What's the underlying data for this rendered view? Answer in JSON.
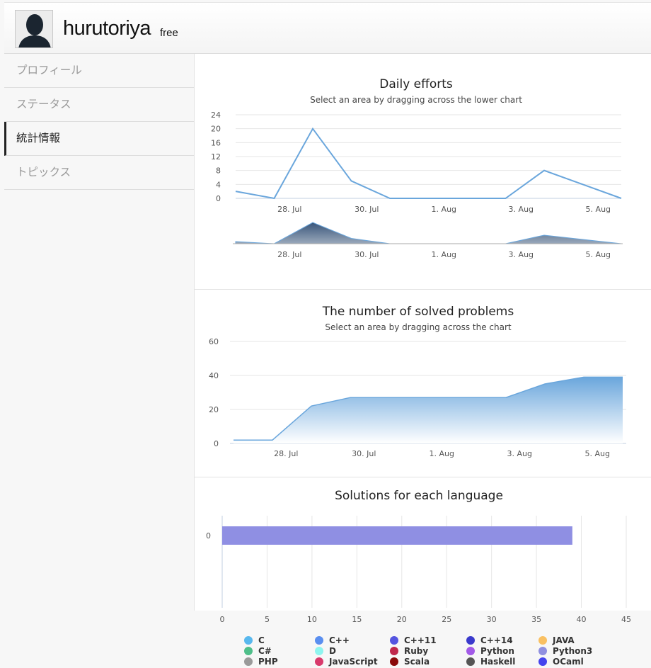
{
  "user": {
    "name": "hurutoriya",
    "plan": "free"
  },
  "sidebar": {
    "items": [
      {
        "label": "プロフィール",
        "active": false
      },
      {
        "label": "ステータス",
        "active": false
      },
      {
        "label": "統計情報",
        "active": true
      },
      {
        "label": "トピックス",
        "active": false
      }
    ]
  },
  "chart_data": [
    {
      "type": "line",
      "title": "Daily efforts",
      "subtitle": "Select an area by dragging across the lower chart",
      "x_tick_labels": [
        "28. Jul",
        "30. Jul",
        "1. Aug",
        "3. Aug",
        "5. Aug"
      ],
      "y_tick_labels": [
        "0",
        "4",
        "8",
        "12",
        "16",
        "20",
        "24"
      ],
      "ylim": [
        0,
        24
      ],
      "x": [
        0,
        1,
        2,
        3,
        4,
        5,
        6,
        7,
        8,
        9,
        10
      ],
      "series": [
        {
          "values": [
            2,
            0,
            20,
            5,
            0,
            0,
            0,
            0,
            8,
            4,
            0
          ],
          "color": "#6aa6dc"
        }
      ],
      "navigator": true
    },
    {
      "type": "area",
      "title": "The number of solved problems",
      "subtitle": "Select an area by dragging across the chart",
      "x_tick_labels": [
        "28. Jul",
        "30. Jul",
        "1. Aug",
        "3. Aug",
        "5. Aug"
      ],
      "y_tick_labels": [
        "0",
        "20",
        "40",
        "60"
      ],
      "ylim": [
        0,
        60
      ],
      "x": [
        0,
        1,
        2,
        3,
        4,
        5,
        6,
        7,
        8,
        9,
        10
      ],
      "series": [
        {
          "values": [
            2,
            2,
            22,
            27,
            27,
            27,
            27,
            27,
            35,
            39,
            39
          ],
          "color": "#6aa6dc"
        }
      ]
    },
    {
      "type": "bar",
      "orientation": "horizontal",
      "title": "Solutions for each language",
      "categories": [
        "0"
      ],
      "values": [
        39
      ],
      "bar_color": "#8f8fe3",
      "xlim": [
        0,
        45
      ],
      "x_tick_labels": [
        "0",
        "5",
        "10",
        "15",
        "20",
        "25",
        "30",
        "35",
        "40",
        "45"
      ],
      "legend": [
        {
          "name": "C",
          "color": "#58b8ee"
        },
        {
          "name": "C++",
          "color": "#5a8ff0"
        },
        {
          "name": "C++11",
          "color": "#5555e0"
        },
        {
          "name": "C++14",
          "color": "#3a3acc"
        },
        {
          "name": "JAVA",
          "color": "#f9c062"
        },
        {
          "name": "C#",
          "color": "#4fbf8a"
        },
        {
          "name": "D",
          "color": "#8ff5ef"
        },
        {
          "name": "Ruby",
          "color": "#c0284b"
        },
        {
          "name": "Python",
          "color": "#a25ae8"
        },
        {
          "name": "Python3",
          "color": "#9090e0"
        },
        {
          "name": "PHP",
          "color": "#9a9a9a"
        },
        {
          "name": "JavaScript",
          "color": "#d83a6c"
        },
        {
          "name": "Scala",
          "color": "#8a0a0a"
        },
        {
          "name": "Haskell",
          "color": "#555555"
        },
        {
          "name": "OCaml",
          "color": "#4444ee"
        }
      ]
    }
  ]
}
